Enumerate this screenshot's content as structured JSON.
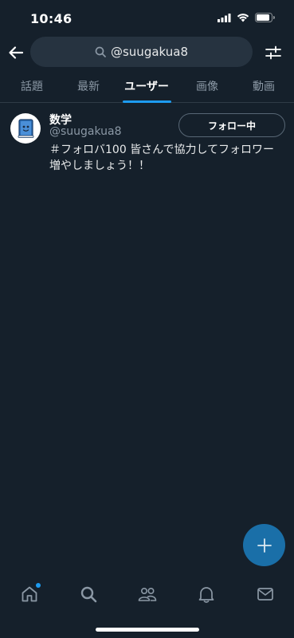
{
  "status_bar": {
    "time": "10:46",
    "icons": [
      "signal-icon",
      "wifi-icon",
      "battery-icon"
    ]
  },
  "header": {
    "back_icon": "arrow-left-icon",
    "search_icon": "search-icon",
    "search_query": "@suugakua8",
    "filter_icon": "sliders-icon"
  },
  "tabs": [
    {
      "label": "話題",
      "active": false
    },
    {
      "label": "最新",
      "active": false
    },
    {
      "label": "ユーザー",
      "active": true
    },
    {
      "label": "画像",
      "active": false
    },
    {
      "label": "動画",
      "active": false
    }
  ],
  "results": [
    {
      "display_name": "数学",
      "handle": "@suugakua8",
      "bio": "＃フォロバ100 皆さんで協力してフォロワー増やしましょう！！",
      "follow_label": "フォロー中"
    }
  ],
  "fab": {
    "icon": "plus-icon"
  },
  "bottom_nav": [
    {
      "name": "home-icon",
      "has_dot": true
    },
    {
      "name": "search-icon",
      "has_dot": false
    },
    {
      "name": "communities-icon",
      "has_dot": false
    },
    {
      "name": "bell-icon",
      "has_dot": false
    },
    {
      "name": "mail-icon",
      "has_dot": false
    }
  ],
  "colors": {
    "background": "#15202b",
    "accent": "#1d9bf0",
    "fab": "#1a6fa8",
    "muted_text": "#8b98a5"
  }
}
